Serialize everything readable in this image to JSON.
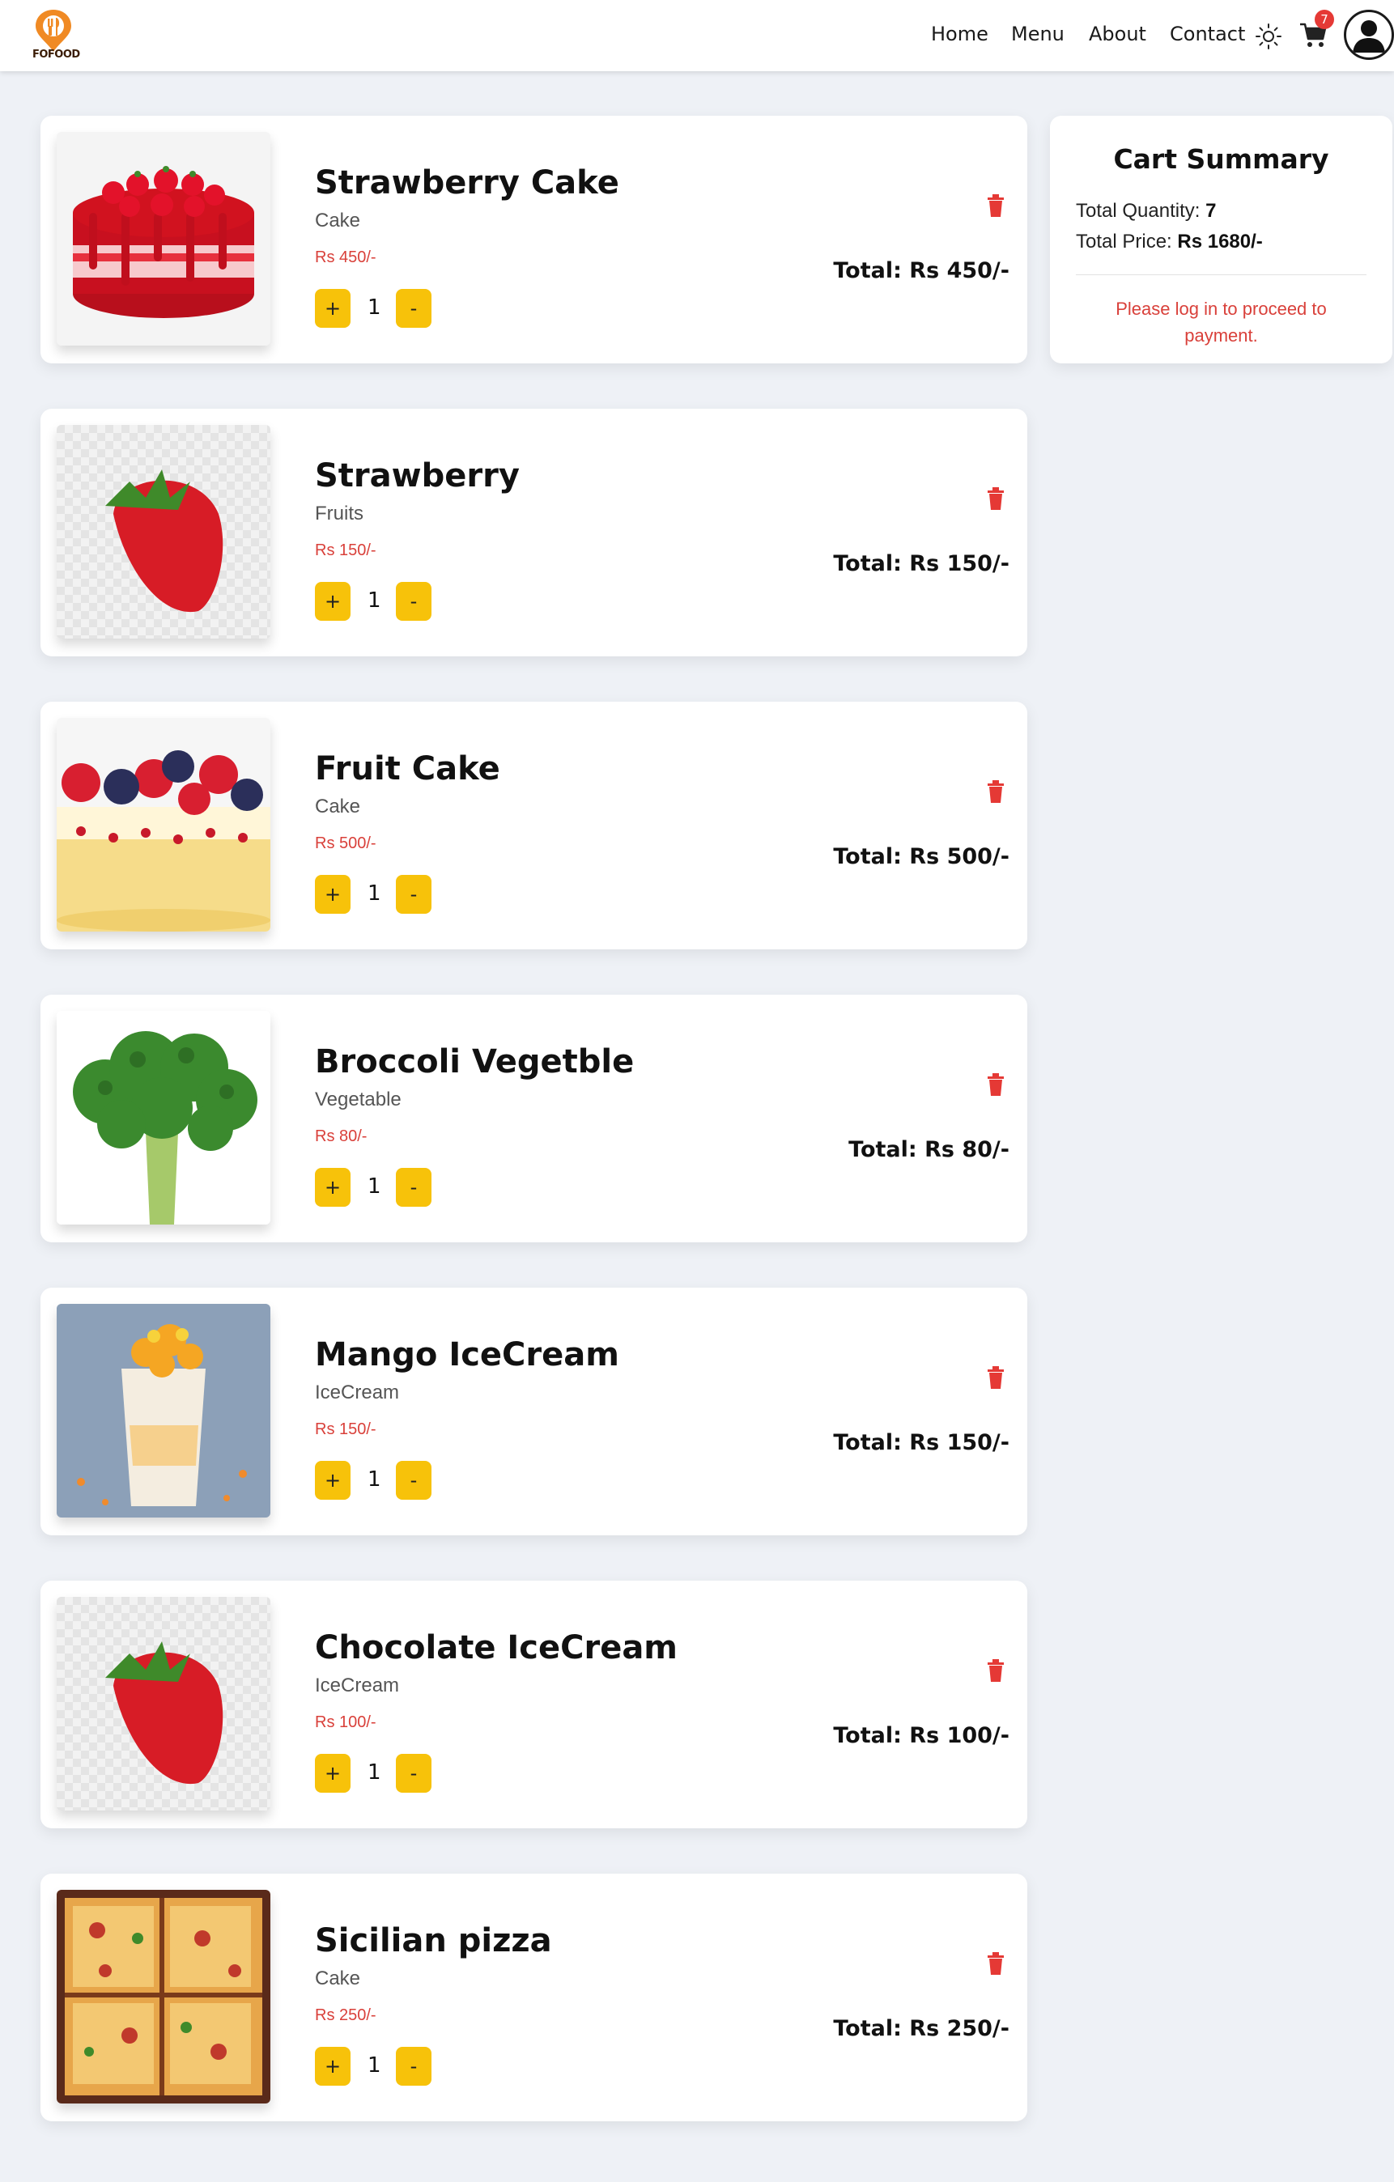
{
  "nav": {
    "logo_text": "FOFOOD",
    "home": "Home",
    "menu": "Menu",
    "about": "About",
    "contact": "Contact",
    "cart_count": "7"
  },
  "items": [
    {
      "name": "Strawberry Cake",
      "category": "Cake",
      "price": "Rs 450/-",
      "plus": "+",
      "qty": "1",
      "minus": "-",
      "total": "Total: Rs 450/-",
      "image": "strawberry-cake"
    },
    {
      "name": "Strawberry",
      "category": "Fruits",
      "price": "Rs 150/-",
      "plus": "+",
      "qty": "1",
      "minus": "-",
      "total": "Total: Rs 150/-",
      "image": "strawberry"
    },
    {
      "name": "Fruit Cake",
      "category": "Cake",
      "price": "Rs 500/-",
      "plus": "+",
      "qty": "1",
      "minus": "-",
      "total": "Total: Rs 500/-",
      "image": "fruit-cake"
    },
    {
      "name": "Broccoli Vegetble",
      "category": "Vegetable",
      "price": "Rs 80/-",
      "plus": "+",
      "qty": "1",
      "minus": "-",
      "total": "Total: Rs 80/-",
      "image": "broccoli"
    },
    {
      "name": "Mango IceCream",
      "category": "IceCream",
      "price": "Rs 150/-",
      "plus": "+",
      "qty": "1",
      "minus": "-",
      "total": "Total: Rs 150/-",
      "image": "mango-icecream"
    },
    {
      "name": "Chocolate IceCream",
      "category": "IceCream",
      "price": "Rs 100/-",
      "plus": "+",
      "qty": "1",
      "minus": "-",
      "total": "Total: Rs 100/-",
      "image": "strawberry"
    },
    {
      "name": "Sicilian pizza",
      "category": "Cake",
      "price": "Rs 250/-",
      "plus": "+",
      "qty": "1",
      "minus": "-",
      "total": "Total: Rs 250/-",
      "image": "pizza"
    }
  ],
  "summary": {
    "title": "Cart Summary",
    "qty_label": "Total Quantity:",
    "qty_value": "7",
    "price_label": "Total Price:",
    "price_value": "Rs 1680/-",
    "note": "Please log in to proceed to payment."
  },
  "colors": {
    "accent_yellow": "#f7c20a",
    "price_red": "#d9403a",
    "badge_red": "#e53935",
    "background": "#eef1f6"
  }
}
